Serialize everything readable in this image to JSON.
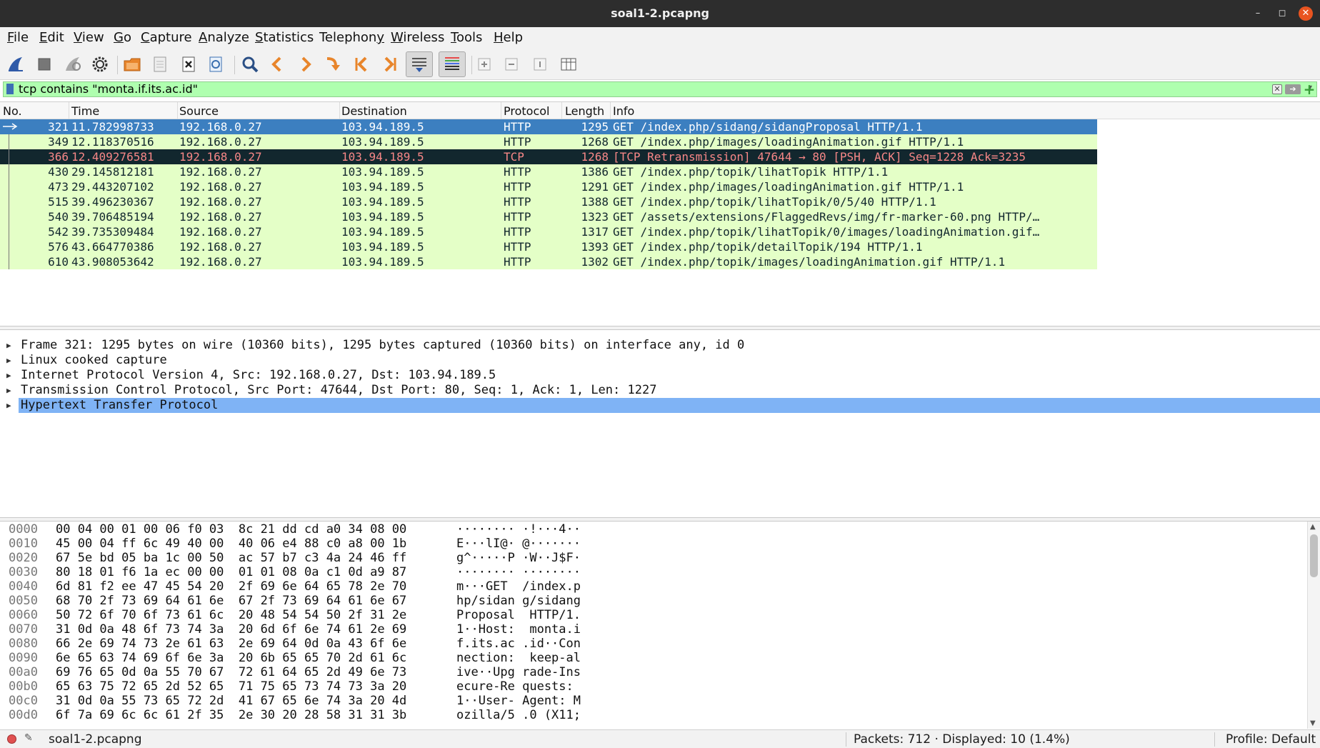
{
  "window": {
    "title": "soal1-2.pcapng"
  },
  "menu": [
    {
      "label": "File",
      "mnemonic": "F",
      "rest": "ile"
    },
    {
      "label": "Edit",
      "mnemonic": "E",
      "rest": "dit"
    },
    {
      "label": "View",
      "mnemonic": "V",
      "rest": "iew"
    },
    {
      "label": "Go",
      "mnemonic": "G",
      "rest": "o"
    },
    {
      "label": "Capture",
      "mnemonic": "C",
      "rest": "apture"
    },
    {
      "label": "Analyze",
      "mnemonic": "A",
      "rest": "nalyze"
    },
    {
      "label": "Statistics",
      "mnemonic": "S",
      "rest": "tatistics"
    },
    {
      "label": "Telephony",
      "mnemonic": "y",
      "rest": "Telephon"
    },
    {
      "label": "Wireless",
      "mnemonic": "W",
      "rest": "ireless"
    },
    {
      "label": "Tools",
      "mnemonic": "T",
      "rest": "ools"
    },
    {
      "label": "Help",
      "mnemonic": "H",
      "rest": "elp"
    }
  ],
  "toolbar": [
    {
      "icon": "shark-fin-start-icon"
    },
    {
      "icon": "stop-capture-icon"
    },
    {
      "icon": "restart-capture-icon"
    },
    {
      "icon": "capture-options-gear-icon"
    },
    {
      "icon": "open-file-icon"
    },
    {
      "icon": "save-file-icon"
    },
    {
      "icon": "close-file-icon"
    },
    {
      "icon": "reload-file-icon"
    },
    {
      "icon": "find-packet-icon"
    },
    {
      "icon": "go-back-icon"
    },
    {
      "icon": "go-forward-icon"
    },
    {
      "icon": "go-to-packet-icon"
    },
    {
      "icon": "first-packet-icon"
    },
    {
      "icon": "last-packet-icon"
    },
    {
      "icon": "autoscroll-icon"
    },
    {
      "icon": "colorize-icon"
    },
    {
      "icon": "zoom-in-icon"
    },
    {
      "icon": "zoom-out-icon"
    },
    {
      "icon": "normal-size-icon"
    },
    {
      "icon": "resize-columns-icon"
    }
  ],
  "filter": {
    "value": "tcp contains \"monta.if.its.ac.id\"",
    "color": "#afffaf"
  },
  "columns": [
    "No.",
    "Time",
    "Source",
    "Destination",
    "Protocol",
    "Length",
    "Info"
  ],
  "packets": [
    {
      "no": "321",
      "time": "11.782998733",
      "src": "192.168.0.27",
      "dst": "103.94.189.5",
      "proto": "HTTP",
      "len": "1295",
      "info": "GET /index.php/sidang/sidangProposal HTTP/1.1",
      "state": "selected"
    },
    {
      "no": "349",
      "time": "12.118370516",
      "src": "192.168.0.27",
      "dst": "103.94.189.5",
      "proto": "HTTP",
      "len": "1268",
      "info": "GET /index.php/images/loadingAnimation.gif HTTP/1.1",
      "state": "normal"
    },
    {
      "no": "366",
      "time": "12.409276581",
      "src": "192.168.0.27",
      "dst": "103.94.189.5",
      "proto": "TCP",
      "len": "1268",
      "info": "[TCP Retransmission] 47644 → 80 [PSH, ACK] Seq=1228 Ack=3235 ",
      "state": "bad"
    },
    {
      "no": "430",
      "time": "29.145812181",
      "src": "192.168.0.27",
      "dst": "103.94.189.5",
      "proto": "HTTP",
      "len": "1386",
      "info": "GET /index.php/topik/lihatTopik HTTP/1.1",
      "state": "normal"
    },
    {
      "no": "473",
      "time": "29.443207102",
      "src": "192.168.0.27",
      "dst": "103.94.189.5",
      "proto": "HTTP",
      "len": "1291",
      "info": "GET /index.php/images/loadingAnimation.gif HTTP/1.1",
      "state": "normal"
    },
    {
      "no": "515",
      "time": "39.496230367",
      "src": "192.168.0.27",
      "dst": "103.94.189.5",
      "proto": "HTTP",
      "len": "1388",
      "info": "GET /index.php/topik/lihatTopik/0/5/40 HTTP/1.1",
      "state": "normal"
    },
    {
      "no": "540",
      "time": "39.706485194",
      "src": "192.168.0.27",
      "dst": "103.94.189.5",
      "proto": "HTTP",
      "len": "1323",
      "info": "GET /assets/extensions/FlaggedRevs/img/fr-marker-60.png HTTP/…",
      "state": "normal"
    },
    {
      "no": "542",
      "time": "39.735309484",
      "src": "192.168.0.27",
      "dst": "103.94.189.5",
      "proto": "HTTP",
      "len": "1317",
      "info": "GET /index.php/topik/lihatTopik/0/images/loadingAnimation.gif…",
      "state": "normal"
    },
    {
      "no": "576",
      "time": "43.664770386",
      "src": "192.168.0.27",
      "dst": "103.94.189.5",
      "proto": "HTTP",
      "len": "1393",
      "info": "GET /index.php/topik/detailTopik/194 HTTP/1.1",
      "state": "normal"
    },
    {
      "no": "610",
      "time": "43.908053642",
      "src": "192.168.0.27",
      "dst": "103.94.189.5",
      "proto": "HTTP",
      "len": "1302",
      "info": "GET /index.php/topik/images/loadingAnimation.gif HTTP/1.1",
      "state": "normal"
    }
  ],
  "details": [
    {
      "text": "Frame 321: 1295 bytes on wire (10360 bits), 1295 bytes captured (10360 bits) on interface any, id 0",
      "selected": false
    },
    {
      "text": "Linux cooked capture",
      "selected": false
    },
    {
      "text": "Internet Protocol Version 4, Src: 192.168.0.27, Dst: 103.94.189.5",
      "selected": false
    },
    {
      "text": "Transmission Control Protocol, Src Port: 47644, Dst Port: 80, Seq: 1, Ack: 1, Len: 1227",
      "selected": false
    },
    {
      "text": "Hypertext Transfer Protocol",
      "selected": true
    }
  ],
  "bytes": [
    {
      "off": "0000",
      "hex": "00 04 00 01 00 06 f0 03  8c 21 dd cd a0 34 08 00",
      "ascii": "········ ·!···4··"
    },
    {
      "off": "0010",
      "hex": "45 00 04 ff 6c 49 40 00  40 06 e4 88 c0 a8 00 1b",
      "ascii": "E···lI@· @·······"
    },
    {
      "off": "0020",
      "hex": "67 5e bd 05 ba 1c 00 50  ac 57 b7 c3 4a 24 46 ff",
      "ascii": "g^·····P ·W··J$F·"
    },
    {
      "off": "0030",
      "hex": "80 18 01 f6 1a ec 00 00  01 01 08 0a c1 0d a9 87",
      "ascii": "········ ········"
    },
    {
      "off": "0040",
      "hex": "6d 81 f2 ee 47 45 54 20  2f 69 6e 64 65 78 2e 70",
      "ascii": "m···GET  /index.p"
    },
    {
      "off": "0050",
      "hex": "68 70 2f 73 69 64 61 6e  67 2f 73 69 64 61 6e 67",
      "ascii": "hp/sidan g/sidang"
    },
    {
      "off": "0060",
      "hex": "50 72 6f 70 6f 73 61 6c  20 48 54 54 50 2f 31 2e",
      "ascii": "Proposal  HTTP/1."
    },
    {
      "off": "0070",
      "hex": "31 0d 0a 48 6f 73 74 3a  20 6d 6f 6e 74 61 2e 69",
      "ascii": "1··Host:  monta.i"
    },
    {
      "off": "0080",
      "hex": "66 2e 69 74 73 2e 61 63  2e 69 64 0d 0a 43 6f 6e",
      "ascii": "f.its.ac .id··Con"
    },
    {
      "off": "0090",
      "hex": "6e 65 63 74 69 6f 6e 3a  20 6b 65 65 70 2d 61 6c",
      "ascii": "nection:  keep-al"
    },
    {
      "off": "00a0",
      "hex": "69 76 65 0d 0a 55 70 67  72 61 64 65 2d 49 6e 73",
      "ascii": "ive··Upg rade-Ins"
    },
    {
      "off": "00b0",
      "hex": "65 63 75 72 65 2d 52 65  71 75 65 73 74 73 3a 20",
      "ascii": "ecure-Re quests: "
    },
    {
      "off": "00c0",
      "hex": "31 0d 0a 55 73 65 72 2d  41 67 65 6e 74 3a 20 4d",
      "ascii": "1··User- Agent: M"
    },
    {
      "off": "00d0",
      "hex": "6f 7a 69 6c 6c 61 2f 35  2e 30 20 28 58 31 31 3b",
      "ascii": "ozilla/5 .0 (X11;"
    }
  ],
  "status": {
    "file": "soal1-2.pcapng",
    "packets": "Packets: 712 · Displayed: 10 (1.4%)",
    "profile": "Profile: Default"
  },
  "colors": {
    "http_row": "#e4ffc7",
    "selected_row": "#3c7fc0",
    "bad_row_bg": "#12272e",
    "bad_row_fg": "#f78787",
    "detail_selected": "#7fb3f5"
  }
}
